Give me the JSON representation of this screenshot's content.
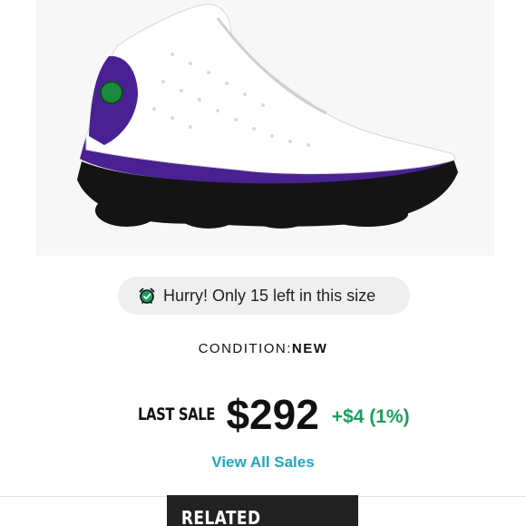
{
  "product": {
    "image_alt": "Air Jordan 13 sneaker, white with purple and black",
    "colors": {
      "upper": "#ffffff",
      "accent": "#4a2192",
      "sole": "#141414",
      "hologram": "#1c8a3e"
    }
  },
  "stock_alert": {
    "icon": "alarm-clock-icon",
    "text": "Hurry! Only 15 left in this size"
  },
  "condition": {
    "label": "CONDITION:",
    "value": "NEW"
  },
  "last_sale": {
    "label": "LAST SALE",
    "price": "$292",
    "change": "+$4 (1%)",
    "change_color": "#1a9e5c"
  },
  "view_all_sales": "View All Sales",
  "related_products": "RELATED PRODUCTS"
}
